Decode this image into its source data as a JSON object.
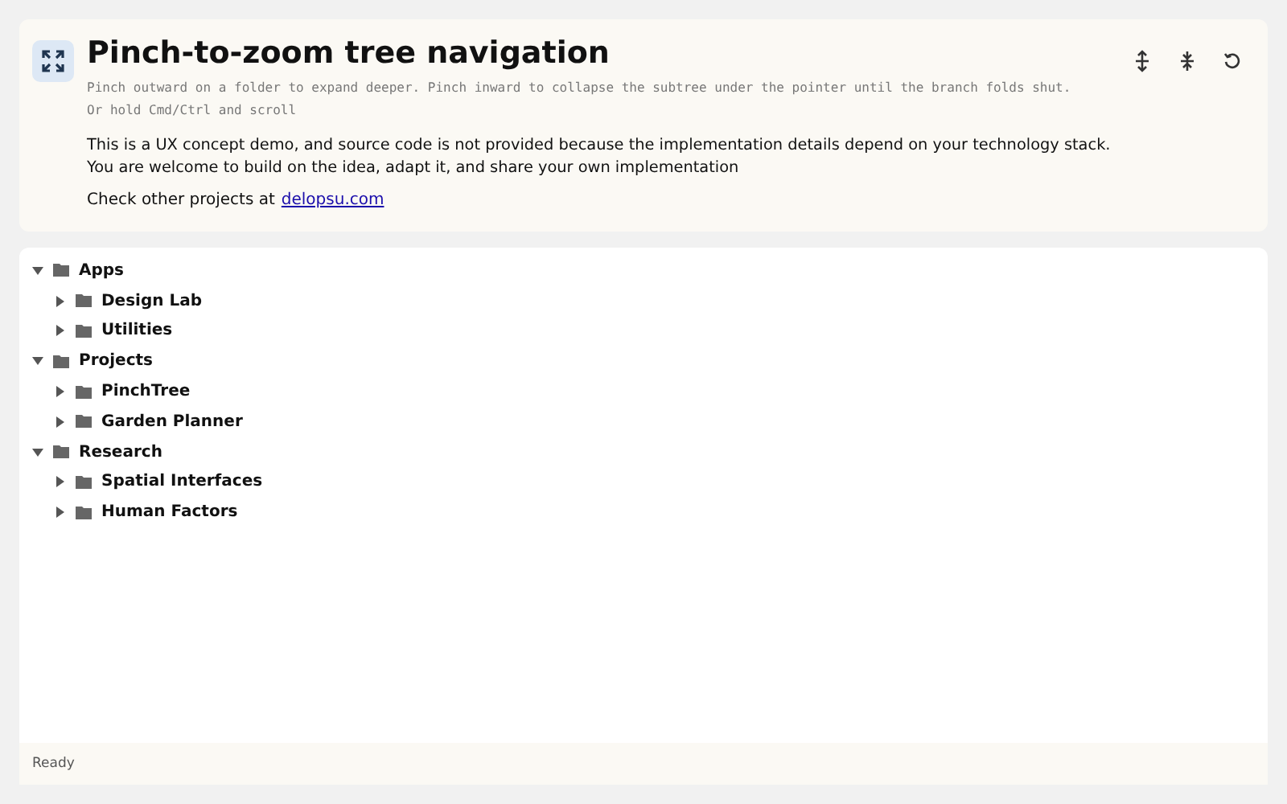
{
  "header": {
    "title": "Pinch-to-zoom tree navigation",
    "hint_lines": [
      "Pinch outward on a folder to expand deeper. Pinch inward to collapse the subtree under the pointer until the branch folds shut.",
      "Or hold Cmd/Ctrl and scroll"
    ],
    "notice_lines": [
      "This is a UX concept demo, and source code is not provided because the implementation details depend on your technology stack.",
      "You are welcome to build on the idea, adapt it, and share your own implementation"
    ],
    "links_text": "Check other projects at",
    "link": "delopsu.com",
    "tools": [
      {
        "kind": "expand"
      },
      {
        "kind": "collapse"
      },
      {
        "kind": "reset"
      }
    ]
  },
  "tree": [
    {
      "label": "Apps",
      "expanded": true,
      "children": [
        {
          "label": "Design Lab",
          "expanded": false
        },
        {
          "label": "Utilities",
          "expanded": false
        }
      ]
    },
    {
      "label": "Projects",
      "expanded": true,
      "children": [
        {
          "label": "PinchTree",
          "expanded": false
        },
        {
          "label": "Garden Planner",
          "expanded": false
        }
      ]
    },
    {
      "label": "Research",
      "expanded": true,
      "children": [
        {
          "label": "Spatial Interfaces",
          "expanded": false
        },
        {
          "label": "Human Factors",
          "expanded": false
        }
      ]
    }
  ],
  "status_bar": {
    "text": "Ready"
  }
}
